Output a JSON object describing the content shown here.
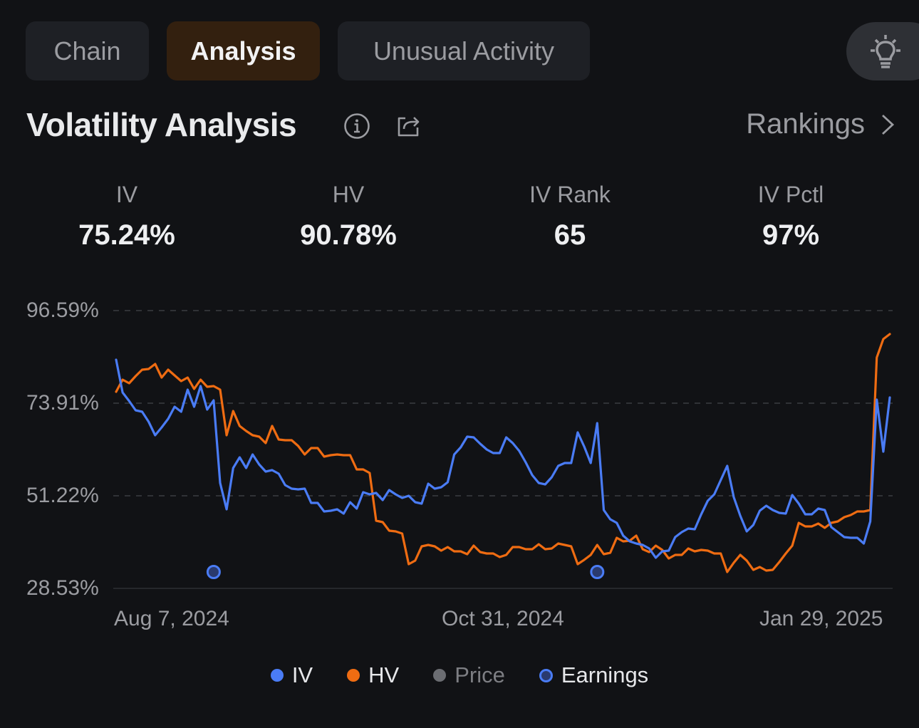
{
  "tabs": [
    {
      "label": "Chain",
      "active": false
    },
    {
      "label": "Analysis",
      "active": true
    },
    {
      "label": "Unusual Activity",
      "active": false
    }
  ],
  "header": {
    "title": "Volatility Analysis",
    "info_icon": "info-icon",
    "share_icon": "share-icon",
    "rankings_label": "Rankings",
    "bulb_icon": "lightbulb-icon"
  },
  "stats": [
    {
      "label": "IV",
      "value": "75.24%"
    },
    {
      "label": "HV",
      "value": "90.78%"
    },
    {
      "label": "IV Rank",
      "value": "65"
    },
    {
      "label": "IV Pctl",
      "value": "97%"
    }
  ],
  "colors": {
    "iv": "#4a7cf5",
    "hv": "#ef6c12",
    "price": "#6b6d72",
    "earnings_fill": "#2a3a6e",
    "earnings_stroke": "#4a7cf5",
    "grid": "#3a3c41"
  },
  "chart_data": {
    "type": "line",
    "title": "Volatility Analysis",
    "xlabel": "",
    "ylabel": "",
    "y_ticks": [
      "96.59%",
      "73.91%",
      "51.22%",
      "28.53%"
    ],
    "ylim": [
      28.53,
      96.59
    ],
    "y_tick_values": [
      96.59,
      73.91,
      51.22,
      28.53
    ],
    "x_ticks": [
      "Aug 7, 2024",
      "Oct 31, 2024",
      "Jan 29, 2025"
    ],
    "grid": true,
    "legend": "bottom",
    "legend_entries": [
      "IV",
      "HV",
      "Price",
      "Earnings"
    ],
    "series": [
      {
        "name": "IV",
        "values": [
          84.55,
          76.52,
          74.43,
          72.16,
          71.81,
          69.37,
          66.05,
          67.97,
          70.06,
          73.03,
          71.81,
          77.22,
          73.03,
          78.09,
          72.33,
          74.6,
          54.36,
          47.9,
          58.02,
          60.64,
          58.02,
          61.34,
          58.9,
          57.15,
          57.5,
          56.63,
          53.84,
          52.96,
          52.79,
          52.96,
          49.47,
          49.47,
          47.38,
          47.55,
          47.9,
          46.85,
          49.65,
          48.08,
          52.09,
          51.57,
          51.92,
          50.17,
          52.61,
          51.57,
          50.69,
          51.22,
          49.65,
          49.3,
          54.18,
          52.96,
          53.31,
          54.53,
          61.34,
          63.08,
          65.7,
          65.53,
          63.96,
          62.56,
          61.69,
          61.69,
          65.53,
          64.13,
          62.21,
          59.42,
          56.28,
          54.36,
          54.01,
          55.75,
          58.55,
          59.24,
          59.24,
          66.75,
          63.26,
          59.24,
          69.02,
          47.73,
          45.46,
          44.59,
          41.44,
          40.05,
          39.53,
          39.18,
          38.3,
          36.04,
          37.61,
          37.78,
          41.1,
          42.32,
          43.19,
          43.02,
          46.68,
          50.0,
          51.57,
          55.06,
          58.55,
          50.87,
          46.33,
          42.49,
          44.06,
          47.55,
          48.77,
          47.73,
          47.03,
          46.85,
          51.39,
          49.3,
          46.68,
          46.68,
          48.08,
          47.73,
          43.54,
          42.32,
          41.1,
          40.92,
          40.92,
          39.53,
          44.94,
          74.78,
          62.04,
          75.3
        ]
      },
      {
        "name": "HV",
        "values": [
          76.7,
          79.66,
          78.79,
          80.54,
          82.11,
          82.28,
          83.5,
          80.19,
          82.11,
          80.71,
          79.31,
          80.19,
          77.39,
          79.66,
          77.92,
          78.09,
          77.22,
          66.05,
          71.98,
          68.32,
          67.1,
          66.05,
          65.7,
          64.13,
          68.32,
          65.0,
          64.83,
          64.83,
          63.43,
          61.34,
          62.91,
          62.91,
          60.81,
          61.16,
          61.34,
          61.16,
          61.16,
          57.67,
          57.67,
          56.8,
          45.11,
          44.76,
          42.67,
          42.49,
          41.97,
          34.47,
          35.34,
          38.83,
          39.18,
          38.83,
          37.78,
          38.65,
          37.61,
          37.61,
          36.91,
          39.0,
          37.43,
          37.08,
          37.08,
          36.21,
          36.73,
          38.65,
          38.65,
          38.13,
          38.13,
          39.35,
          38.13,
          38.3,
          39.53,
          39.18,
          38.83,
          34.47,
          35.52,
          36.73,
          39.18,
          36.91,
          37.26,
          40.92,
          40.05,
          40.23,
          41.44,
          38.13,
          37.43,
          39.0,
          37.96,
          35.86,
          36.73,
          36.73,
          38.3,
          37.61,
          37.96,
          37.78,
          37.08,
          37.08,
          32.54,
          34.81,
          36.73,
          35.34,
          33.07,
          33.77,
          32.9,
          33.07,
          34.99,
          37.08,
          39.0,
          44.59,
          43.71,
          43.71,
          44.41,
          43.36,
          44.59,
          44.94,
          45.98,
          46.5,
          47.38,
          47.38,
          47.73,
          85.07,
          89.61,
          90.83
        ]
      }
    ],
    "earnings_markers": [
      {
        "index": 15
      },
      {
        "index": 74
      }
    ]
  }
}
